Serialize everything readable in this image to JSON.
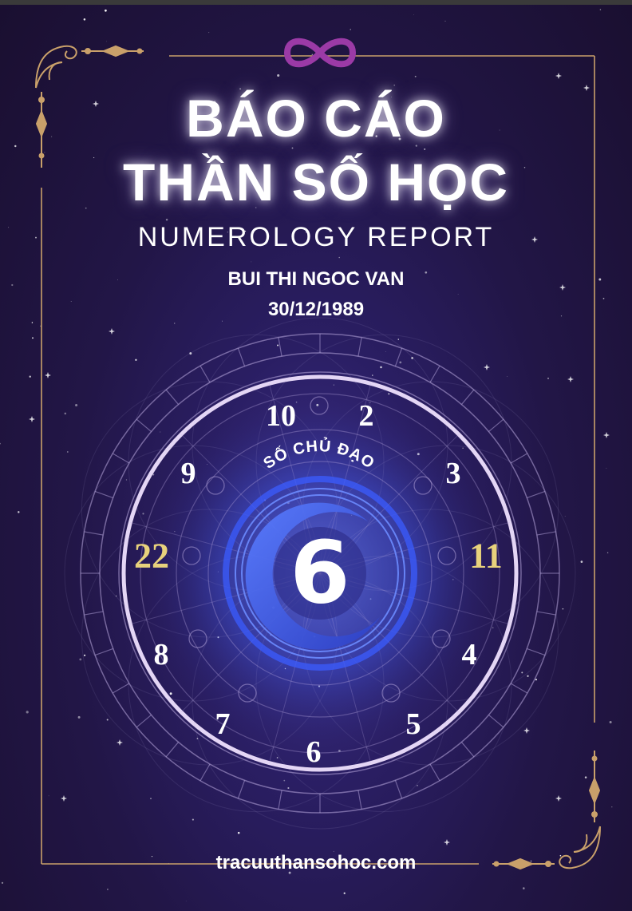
{
  "cover": {
    "title_line1": "BÁO CÁO",
    "title_line2": "THẦN SỐ HỌC",
    "subtitle": "NUMEROLOGY REPORT",
    "person_name": "BUI THI NGOC VAN",
    "birth_date": "30/12/1989",
    "website": "tracuuthansohoc.com",
    "wheel_label": "SỐ CHỦ ĐẠO",
    "main_number": "6",
    "wheel_numbers": [
      "10",
      "2",
      "3",
      "11",
      "4",
      "5",
      "6",
      "7",
      "8",
      "22",
      "9"
    ]
  },
  "colors": {
    "background": "#221647",
    "gold": "#c9a06a",
    "master_number": "#e8d27c",
    "infinity_logo": "#9b3aa6",
    "wheel_ring": "#e4d6f5"
  },
  "icons": [
    "infinity-logo-icon",
    "corner-flourish-icon"
  ]
}
